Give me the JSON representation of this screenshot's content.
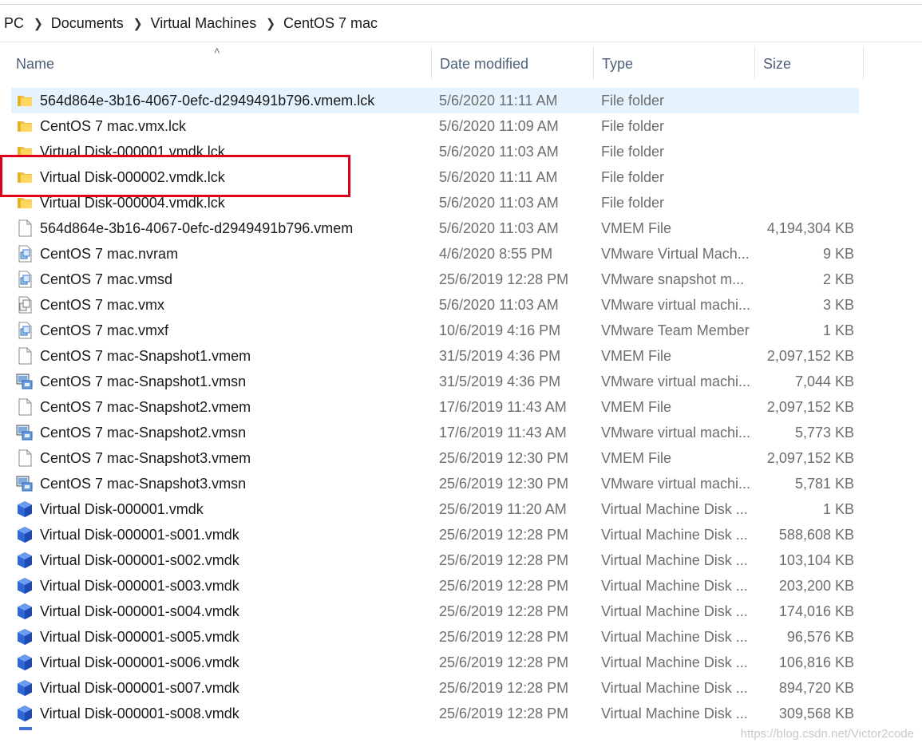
{
  "breadcrumb": [
    "PC",
    "Documents",
    "Virtual Machines",
    "CentOS 7 mac"
  ],
  "columns": {
    "name": "Name",
    "date": "Date modified",
    "type": "Type",
    "size": "Size"
  },
  "files": [
    {
      "name": "564d864e-3b16-4067-0efc-d2949491b796.vmem.lck",
      "date": "5/6/2020 11:11 AM",
      "type": "File folder",
      "size": "",
      "icon": "folder-icon"
    },
    {
      "name": "CentOS 7 mac.vmx.lck",
      "date": "5/6/2020 11:09 AM",
      "type": "File folder",
      "size": "",
      "icon": "folder-icon"
    },
    {
      "name": "Virtual Disk-000001.vmdk.lck",
      "date": "5/6/2020 11:03 AM",
      "type": "File folder",
      "size": "",
      "icon": "folder-icon"
    },
    {
      "name": "Virtual Disk-000002.vmdk.lck",
      "date": "5/6/2020 11:11 AM",
      "type": "File folder",
      "size": "",
      "icon": "folder-icon"
    },
    {
      "name": "Virtual Disk-000004.vmdk.lck",
      "date": "5/6/2020 11:03 AM",
      "type": "File folder",
      "size": "",
      "icon": "folder-icon"
    },
    {
      "name": "564d864e-3b16-4067-0efc-d2949491b796.vmem",
      "date": "5/6/2020 11:03 AM",
      "type": "VMEM File",
      "size": "4,194,304 KB",
      "icon": "blank-file-icon"
    },
    {
      "name": "CentOS 7 mac.nvram",
      "date": "4/6/2020 8:55 PM",
      "type": "VMware Virtual Mach...",
      "size": "9 KB",
      "icon": "vmware-file-icon"
    },
    {
      "name": "CentOS 7 mac.vmsd",
      "date": "25/6/2019 12:28 PM",
      "type": "VMware snapshot m...",
      "size": "2 KB",
      "icon": "vmware-file-icon"
    },
    {
      "name": "CentOS 7 mac.vmx",
      "date": "5/6/2020 11:03 AM",
      "type": "VMware virtual machi...",
      "size": "3 KB",
      "icon": "vmx-file-icon"
    },
    {
      "name": "CentOS 7 mac.vmxf",
      "date": "10/6/2019 4:16 PM",
      "type": "VMware Team Member",
      "size": "1 KB",
      "icon": "vmware-file-icon"
    },
    {
      "name": "CentOS 7 mac-Snapshot1.vmem",
      "date": "31/5/2019 4:36 PM",
      "type": "VMEM File",
      "size": "2,097,152 KB",
      "icon": "blank-file-icon"
    },
    {
      "name": "CentOS 7 mac-Snapshot1.vmsn",
      "date": "31/5/2019 4:36 PM",
      "type": "VMware virtual machi...",
      "size": "7,044 KB",
      "icon": "snapshot-file-icon"
    },
    {
      "name": "CentOS 7 mac-Snapshot2.vmem",
      "date": "17/6/2019 11:43 AM",
      "type": "VMEM File",
      "size": "2,097,152 KB",
      "icon": "blank-file-icon"
    },
    {
      "name": "CentOS 7 mac-Snapshot2.vmsn",
      "date": "17/6/2019 11:43 AM",
      "type": "VMware virtual machi...",
      "size": "5,773 KB",
      "icon": "snapshot-file-icon"
    },
    {
      "name": "CentOS 7 mac-Snapshot3.vmem",
      "date": "25/6/2019 12:30 PM",
      "type": "VMEM File",
      "size": "2,097,152 KB",
      "icon": "blank-file-icon"
    },
    {
      "name": "CentOS 7 mac-Snapshot3.vmsn",
      "date": "25/6/2019 12:30 PM",
      "type": "VMware virtual machi...",
      "size": "5,781 KB",
      "icon": "snapshot-file-icon"
    },
    {
      "name": "Virtual Disk-000001.vmdk",
      "date": "25/6/2019 11:20 AM",
      "type": "Virtual Machine Disk ...",
      "size": "1 KB",
      "icon": "disk-cube-icon"
    },
    {
      "name": "Virtual Disk-000001-s001.vmdk",
      "date": "25/6/2019 12:28 PM",
      "type": "Virtual Machine Disk ...",
      "size": "588,608 KB",
      "icon": "disk-cube-icon"
    },
    {
      "name": "Virtual Disk-000001-s002.vmdk",
      "date": "25/6/2019 12:28 PM",
      "type": "Virtual Machine Disk ...",
      "size": "103,104 KB",
      "icon": "disk-cube-icon"
    },
    {
      "name": "Virtual Disk-000001-s003.vmdk",
      "date": "25/6/2019 12:28 PM",
      "type": "Virtual Machine Disk ...",
      "size": "203,200 KB",
      "icon": "disk-cube-icon"
    },
    {
      "name": "Virtual Disk-000001-s004.vmdk",
      "date": "25/6/2019 12:28 PM",
      "type": "Virtual Machine Disk ...",
      "size": "174,016 KB",
      "icon": "disk-cube-icon"
    },
    {
      "name": "Virtual Disk-000001-s005.vmdk",
      "date": "25/6/2019 12:28 PM",
      "type": "Virtual Machine Disk ...",
      "size": "96,576 KB",
      "icon": "disk-cube-icon"
    },
    {
      "name": "Virtual Disk-000001-s006.vmdk",
      "date": "25/6/2019 12:28 PM",
      "type": "Virtual Machine Disk ...",
      "size": "106,816 KB",
      "icon": "disk-cube-icon"
    },
    {
      "name": "Virtual Disk-000001-s007.vmdk",
      "date": "25/6/2019 12:28 PM",
      "type": "Virtual Machine Disk ...",
      "size": "894,720 KB",
      "icon": "disk-cube-icon"
    },
    {
      "name": "Virtual Disk-000001-s008.vmdk",
      "date": "25/6/2019 12:28 PM",
      "type": "Virtual Machine Disk ...",
      "size": "309,568 KB",
      "icon": "disk-cube-icon"
    }
  ],
  "selected_row": 0,
  "watermark": "https://blog.csdn.net/Victor2code",
  "colors": {
    "selection": "#e5f3ff",
    "highlight_box": "#e0001b",
    "header_text": "#4c607a",
    "secondary_text": "#6d6d6d"
  }
}
